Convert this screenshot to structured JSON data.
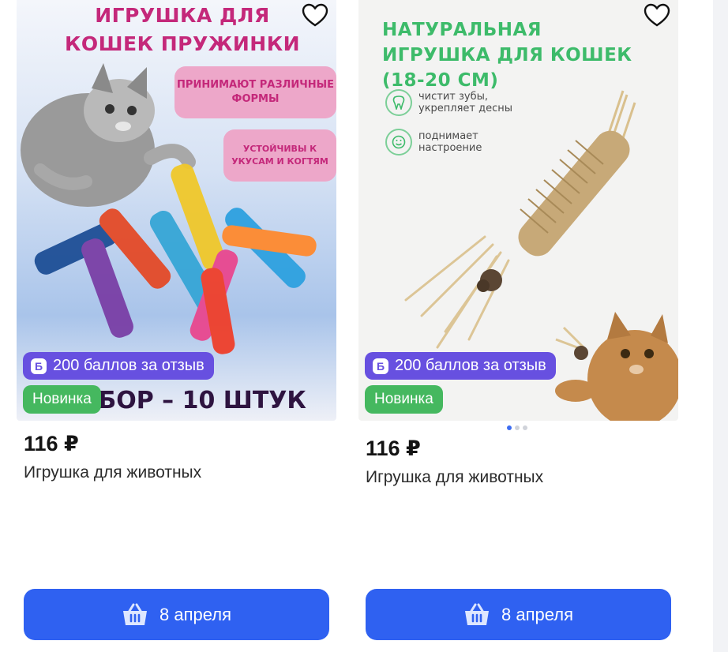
{
  "cards": [
    {
      "image_texts": {
        "headline": "ИГРУШКА ДЛЯ КОШЕК ПРУЖИНКИ",
        "callout_1": "ПРИНИМАЮТ РАЗЛИЧНЫЕ ФОРМЫ",
        "callout_2": "УСТОЙЧИВЫ К УКУСАМ И КОГТЯМ",
        "bottom": "НАБОР – 10 ШТУК"
      },
      "points_badge": "200 баллов за отзыв",
      "points_icon": "Б",
      "new_badge": "Новинка",
      "price": "116 ₽",
      "title": "Игрушка для животных",
      "cart_label": "8 апреля"
    },
    {
      "image_texts": {
        "headline": "НАТУРАЛЬНАЯ ИГРУШКА ДЛЯ КОШЕК (18-20 СМ)",
        "feature_1": "чистит зубы, укрепляет десны",
        "feature_2": "поднимает настроение"
      },
      "points_badge": "200 баллов за отзыв",
      "points_icon": "Б",
      "new_badge": "Новинка",
      "price": "116 ₽",
      "title": "Игрушка для животных",
      "cart_label": "8 апреля",
      "carousel": {
        "count": 3,
        "active": 1
      }
    }
  ],
  "colors": {
    "accent": "#2f61f1",
    "points_badge": "#6750e0",
    "new_badge": "#45b85f"
  },
  "icons": [
    "heart-icon",
    "basket-icon",
    "points-icon",
    "tooth-icon",
    "smile-icon"
  ]
}
